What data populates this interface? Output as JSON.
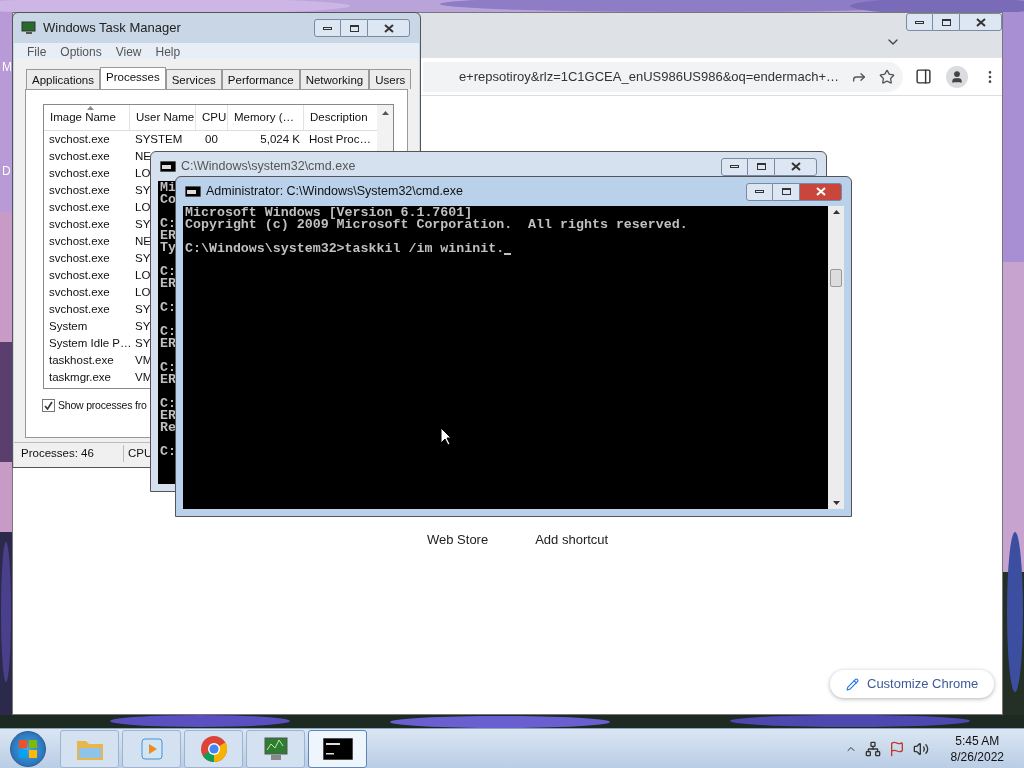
{
  "desktop": {
    "icon_labels": [
      "M",
      "D"
    ]
  },
  "browser": {
    "address": "e+repsotiroy&rlz=1C1GCEA_enUS986US986&oq=endermach+…",
    "shortcuts": [
      "Web Store",
      "Add shortcut"
    ],
    "customize_button": "Customize Chrome"
  },
  "task_manager": {
    "title": "Windows Task Manager",
    "menu": [
      "File",
      "Options",
      "View",
      "Help"
    ],
    "tabs": [
      {
        "label": "Applications",
        "selected": false
      },
      {
        "label": "Processes",
        "selected": true
      },
      {
        "label": "Services",
        "selected": false
      },
      {
        "label": "Performance",
        "selected": false
      },
      {
        "label": "Networking",
        "selected": false
      },
      {
        "label": "Users",
        "selected": false
      }
    ],
    "columns": [
      "Image Name",
      "User Name",
      "CPU",
      "Memory (…",
      "Description"
    ],
    "rows": [
      {
        "image_name": "svchost.exe",
        "user_name": "SYSTEM",
        "cpu": "00",
        "memory": "5,024 K",
        "description": "Host Proc…"
      },
      {
        "image_name": "svchost.exe",
        "user_name": "NE"
      },
      {
        "image_name": "svchost.exe",
        "user_name": "LO"
      },
      {
        "image_name": "svchost.exe",
        "user_name": "SY"
      },
      {
        "image_name": "svchost.exe",
        "user_name": "LO"
      },
      {
        "image_name": "svchost.exe",
        "user_name": "SY"
      },
      {
        "image_name": "svchost.exe",
        "user_name": "NE"
      },
      {
        "image_name": "svchost.exe",
        "user_name": "SY"
      },
      {
        "image_name": "svchost.exe",
        "user_name": "LO"
      },
      {
        "image_name": "svchost.exe",
        "user_name": "LO"
      },
      {
        "image_name": "svchost.exe",
        "user_name": "SY"
      },
      {
        "image_name": "System",
        "user_name": "SY"
      },
      {
        "image_name": "System Idle P…",
        "user_name": "SY"
      },
      {
        "image_name": "taskhost.exe",
        "user_name": "VM"
      },
      {
        "image_name": "taskmgr.exe",
        "user_name": "VM"
      }
    ],
    "show_processes": {
      "label": "Show processes fro",
      "checked": true
    },
    "status_bar": [
      "Processes: 46",
      "CPU"
    ]
  },
  "console_back": {
    "title": "C:\\Windows\\system32\\cmd.exe",
    "blocks": [
      [
        "Mi",
        "Co"
      ],
      [
        "C:",
        "ER",
        "Ty"
      ],
      [
        "C:",
        "ER"
      ],
      [
        "C:"
      ],
      [
        "C:",
        "ER"
      ],
      [
        "C:",
        "ER"
      ],
      [
        "C:",
        "ER",
        "Re"
      ],
      [
        "C:"
      ]
    ]
  },
  "console_front": {
    "title": "Administrator: C:\\Windows\\System32\\cmd.exe",
    "blocks": [
      [
        "Microsoft Windows [Version 6.1.7601]",
        "Copyright (c) 2009 Microsoft Corporation.  All rights reserved."
      ],
      [
        "C:\\Windows\\system32>taskkil /im wininit."
      ]
    ]
  },
  "taskbar": {
    "buttons": [
      {
        "kind": "folder",
        "selected": false
      },
      {
        "kind": "media",
        "selected": false
      },
      {
        "kind": "chrome",
        "selected": false
      },
      {
        "kind": "taskmgr",
        "selected": false
      },
      {
        "kind": "console",
        "selected": true
      }
    ],
    "time": "5:45 AM",
    "date": "8/26/2022"
  }
}
